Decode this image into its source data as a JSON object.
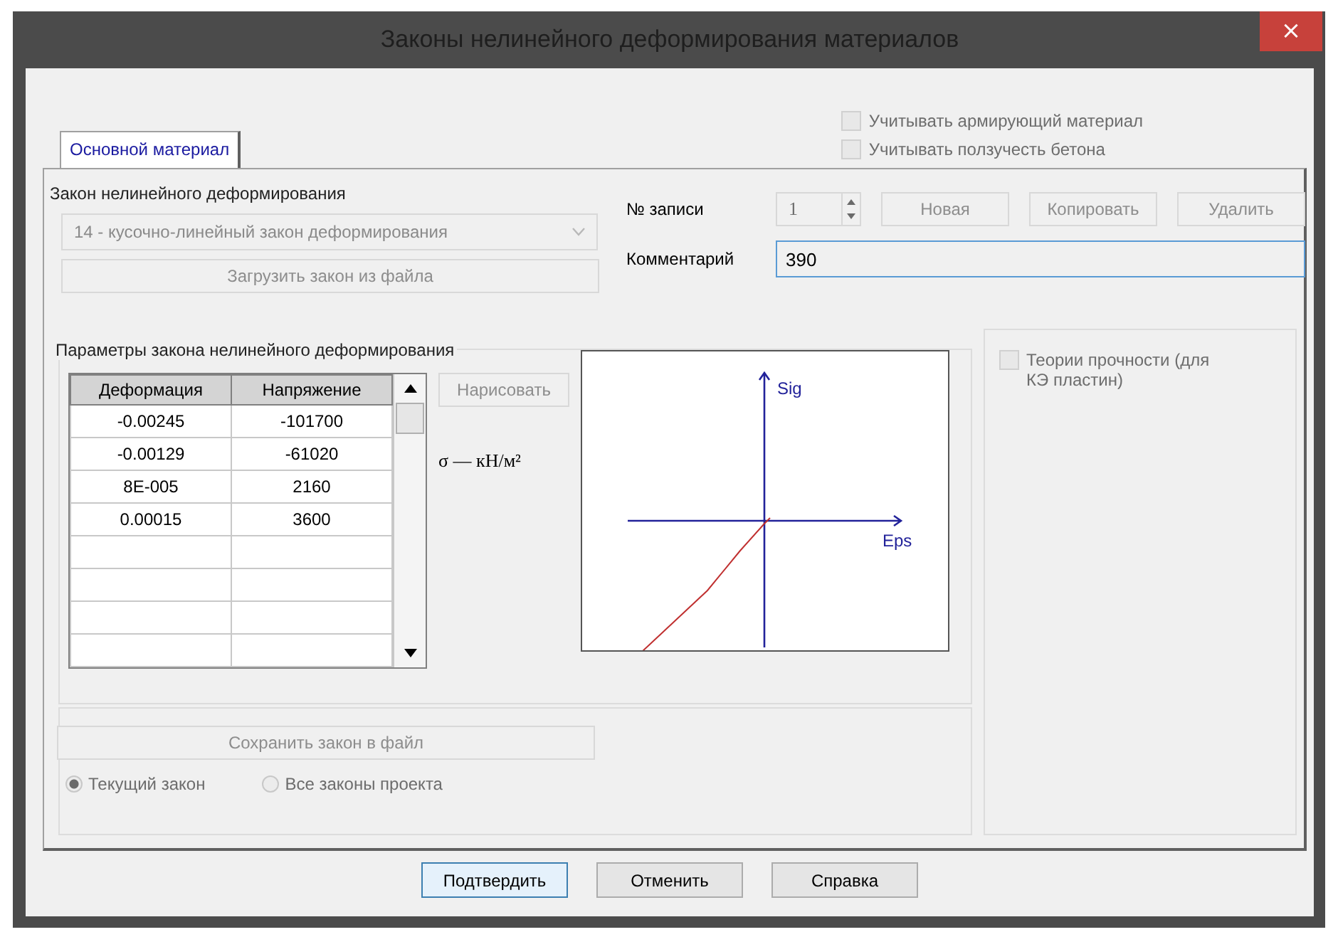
{
  "window": {
    "title": "Законы нелинейного деформирования материалов",
    "close": "×"
  },
  "options": [
    {
      "label": "Учитывать армирующий материал",
      "checked": false,
      "disabled": true
    },
    {
      "label": "Учитывать ползучесть бетона",
      "checked": false,
      "disabled": true
    }
  ],
  "tabs": [
    {
      "label": "Основной материал",
      "selected": true
    }
  ],
  "law": {
    "label": "Закон нелинейного деформирования",
    "value": "14 - кусочно-линейный закон деформирования",
    "disabled": true,
    "load_button": {
      "label": "Загрузить закон из файла",
      "disabled": true
    }
  },
  "record": {
    "label": "№ записи",
    "value": "1",
    "buttons": [
      {
        "label": "Новая",
        "disabled": true
      },
      {
        "label": "Копировать",
        "disabled": true
      },
      {
        "label": "Удалить",
        "disabled": true
      }
    ]
  },
  "comment": {
    "label": "Комментарий",
    "value": "390"
  },
  "params": {
    "title": "Параметры закона нелинейного деформирования",
    "table": {
      "columns": [
        "Деформация",
        "Напряжение"
      ],
      "rows": [
        [
          "-0.00245",
          "-101700"
        ],
        [
          "-0.00129",
          "-61020"
        ],
        [
          "8E-005",
          "2160"
        ],
        [
          "0.00015",
          "3600"
        ],
        [
          "",
          ""
        ],
        [
          "",
          ""
        ],
        [
          "",
          ""
        ],
        [
          "",
          ""
        ]
      ]
    },
    "draw_button": {
      "label": "Нарисовать",
      "disabled": true
    },
    "units": "σ — кН/м²",
    "plot": {
      "y_label": "Sig",
      "x_label": "Eps"
    }
  },
  "strength": {
    "label": "Теории прочности (для КЭ пластин)",
    "checked": false,
    "disabled": true
  },
  "save": {
    "button": {
      "label": "Сохранить закон в файл",
      "disabled": true
    },
    "radios": [
      {
        "label": "Текущий закон",
        "selected": true
      },
      {
        "label": "Все законы проекта",
        "selected": false
      }
    ]
  },
  "buttons": [
    {
      "label": "Подтвердить",
      "focused": true
    },
    {
      "label": "Отменить",
      "focused": false
    },
    {
      "label": "Справка",
      "focused": false
    }
  ]
}
